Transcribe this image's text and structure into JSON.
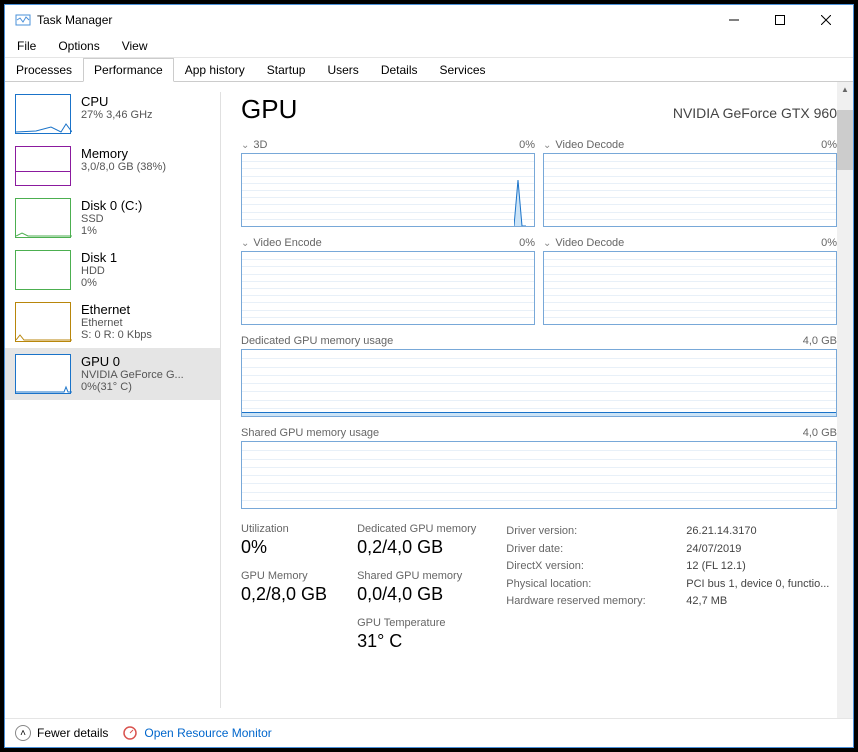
{
  "window": {
    "title": "Task Manager"
  },
  "menu": {
    "file": "File",
    "options": "Options",
    "view": "View"
  },
  "tabs": [
    "Processes",
    "Performance",
    "App history",
    "Startup",
    "Users",
    "Details",
    "Services"
  ],
  "sidebar": {
    "cpu": {
      "title": "CPU",
      "sub": "27% 3,46 GHz"
    },
    "mem": {
      "title": "Memory",
      "sub": "3,0/8,0 GB (38%)"
    },
    "disk0": {
      "title": "Disk 0 (C:)",
      "sub1": "SSD",
      "sub2": "1%"
    },
    "disk1": {
      "title": "Disk 1",
      "sub1": "HDD",
      "sub2": "0%"
    },
    "eth": {
      "title": "Ethernet",
      "sub1": "Ethernet",
      "sub2": "S: 0 R: 0 Kbps"
    },
    "gpu": {
      "title": "GPU 0",
      "sub1": "NVIDIA GeForce G...",
      "sub2": "0%(31° C)"
    }
  },
  "main": {
    "title": "GPU",
    "device": "NVIDIA GeForce GTX 960",
    "g1": {
      "name": "3D",
      "pct": "0%"
    },
    "g2": {
      "name": "Video Decode",
      "pct": "0%"
    },
    "g3": {
      "name": "Video Encode",
      "pct": "0%"
    },
    "g4": {
      "name": "Video Decode",
      "pct": "0%"
    },
    "g5": {
      "name": "Dedicated GPU memory usage",
      "cap": "4,0 GB"
    },
    "g6": {
      "name": "Shared GPU memory usage",
      "cap": "4,0 GB"
    }
  },
  "stats": {
    "util_l": "Utilization",
    "util_v": "0%",
    "gmem_l": "GPU Memory",
    "gmem_v": "0,2/8,0 GB",
    "ded_l": "Dedicated GPU memory",
    "ded_v": "0,2/4,0 GB",
    "shr_l": "Shared GPU memory",
    "shr_v": "0,0/4,0 GB",
    "tmp_l": "GPU Temperature",
    "tmp_v": "31° C"
  },
  "kv": {
    "drv_ver_l": "Driver version:",
    "drv_ver_v": "26.21.14.3170",
    "drv_date_l": "Driver date:",
    "drv_date_v": "24/07/2019",
    "dx_l": "DirectX version:",
    "dx_v": "12 (FL 12.1)",
    "loc_l": "Physical location:",
    "loc_v": "PCI bus 1, device 0, functio...",
    "hwr_l": "Hardware reserved memory:",
    "hwr_v": "42,7 MB"
  },
  "footer": {
    "fewer": "Fewer details",
    "orm": "Open Resource Monitor"
  },
  "chart_data": {
    "type": "line",
    "panels": [
      {
        "name": "3D",
        "ylim": [
          0,
          100
        ],
        "values": [
          0,
          0,
          0,
          0,
          0,
          0,
          0,
          0,
          0,
          0,
          0,
          0,
          0,
          0,
          0,
          0,
          0,
          0,
          62,
          0
        ],
        "unit": "%"
      },
      {
        "name": "Video Decode",
        "ylim": [
          0,
          100
        ],
        "values": [
          0,
          0,
          0,
          0,
          0,
          0,
          0,
          0,
          0,
          0,
          0,
          0,
          0,
          0,
          0,
          0,
          0,
          0,
          0,
          0
        ],
        "unit": "%"
      },
      {
        "name": "Video Encode",
        "ylim": [
          0,
          100
        ],
        "values": [
          0,
          0,
          0,
          0,
          0,
          0,
          0,
          0,
          0,
          0,
          0,
          0,
          0,
          0,
          0,
          0,
          0,
          0,
          0,
          0
        ],
        "unit": "%"
      },
      {
        "name": "Video Decode (2)",
        "ylim": [
          0,
          100
        ],
        "values": [
          0,
          0,
          0,
          0,
          0,
          0,
          0,
          0,
          0,
          0,
          0,
          0,
          0,
          0,
          0,
          0,
          0,
          0,
          0,
          0
        ],
        "unit": "%"
      },
      {
        "name": "Dedicated GPU memory usage",
        "ylim": [
          0,
          4.0
        ],
        "values": [
          0.2,
          0.2,
          0.2,
          0.2,
          0.2,
          0.2,
          0.2,
          0.2,
          0.2,
          0.2,
          0.2,
          0.2,
          0.2,
          0.2,
          0.2,
          0.2,
          0.2,
          0.2,
          0.2,
          0.2
        ],
        "unit": "GB"
      },
      {
        "name": "Shared GPU memory usage",
        "ylim": [
          0,
          4.0
        ],
        "values": [
          0.0,
          0.0,
          0.0,
          0.0,
          0.0,
          0.0,
          0.0,
          0.0,
          0.0,
          0.0,
          0.0,
          0.0,
          0.0,
          0.0,
          0.0,
          0.0,
          0.0,
          0.0,
          0.0,
          0.0
        ],
        "unit": "GB"
      }
    ]
  }
}
